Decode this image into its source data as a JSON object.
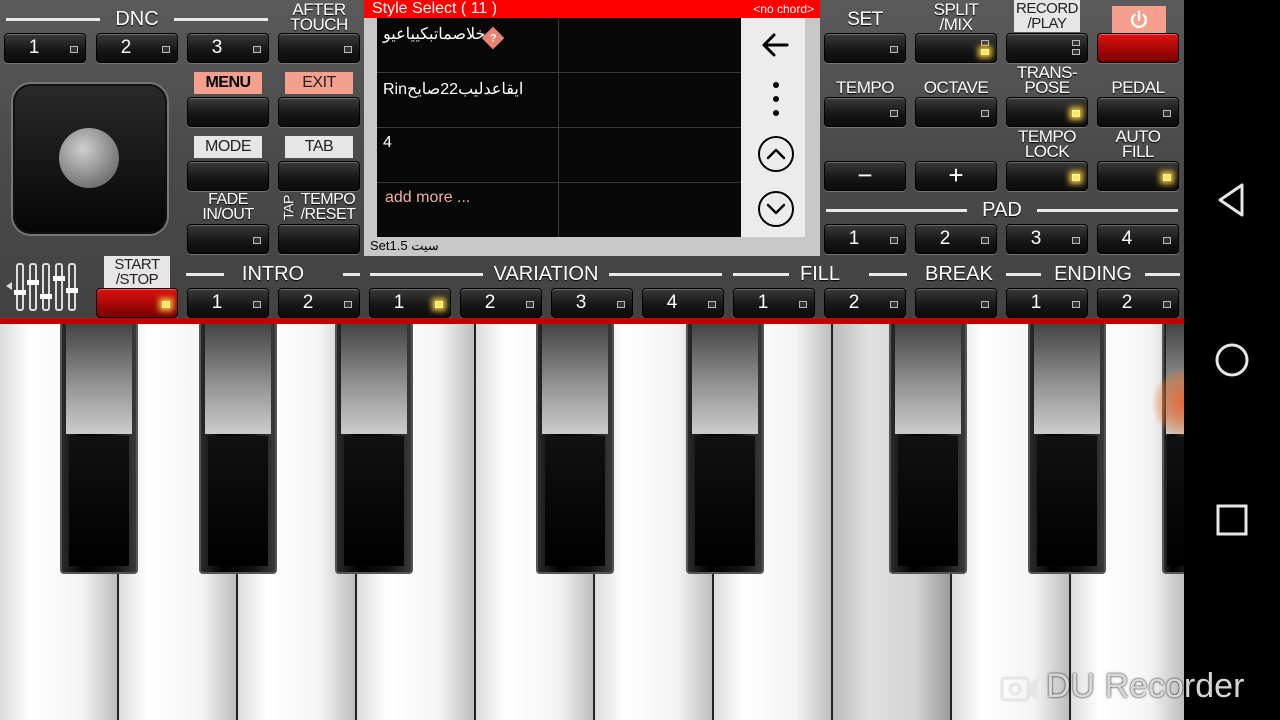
{
  "sections": {
    "dnc": "DNC",
    "intro": "INTRO",
    "variation": "VARIATION",
    "fill": "FILL",
    "break": "BREAK",
    "ending": "ENDING",
    "pad": "PAD"
  },
  "labels": {
    "after_touch": "AFTER\nTOUCH",
    "menu": "MENU",
    "exit": "EXIT",
    "mode": "MODE",
    "tab": "TAB",
    "fade": "FADE\nIN/OUT",
    "tap": "TAP",
    "tempo_reset": "TEMPO\n/RESET",
    "start_stop": "START\n/STOP",
    "set": "SET",
    "split_mix": "SPLIT\n/MIX",
    "record_play": "RECORD\n/PLAY",
    "tempo": "TEMPO",
    "octave": "OCTAVE",
    "transpose": "TRANS-\nPOSE",
    "pedal": "PEDAL",
    "tempo_lock": "TEMPO\nLOCK",
    "auto_fill": "AUTO\nFILL"
  },
  "dnc_buttons": [
    "1",
    "2",
    "3"
  ],
  "intro_buttons": [
    "1",
    "2"
  ],
  "variation_buttons": [
    "1",
    "2",
    "3",
    "4"
  ],
  "fill_buttons": [
    "1",
    "2"
  ],
  "ending_buttons": [
    "1",
    "2"
  ],
  "pad_buttons": [
    "1",
    "2",
    "3",
    "4"
  ],
  "tempo_minus": "−",
  "tempo_plus": "+",
  "screen": {
    "title": "Style Select ( 11 )",
    "chord": "<no chord>",
    "items": [
      "خلاصماتبكيياعيو",
      "Rinايقاعدليب22صايح",
      "4",
      "add more ..."
    ],
    "footer": "Set1.5 سيت"
  },
  "icons": {
    "back": "arrow-left-icon",
    "more": "more-vert-icon",
    "up": "chevron-up-circle-icon",
    "down": "chevron-down-circle-icon",
    "power": "power-icon"
  },
  "watermark": "DU Recorder",
  "colors": {
    "accent_red": "#ff0000",
    "led_on": "#ffe65c",
    "panel": "#4a4a4a"
  }
}
